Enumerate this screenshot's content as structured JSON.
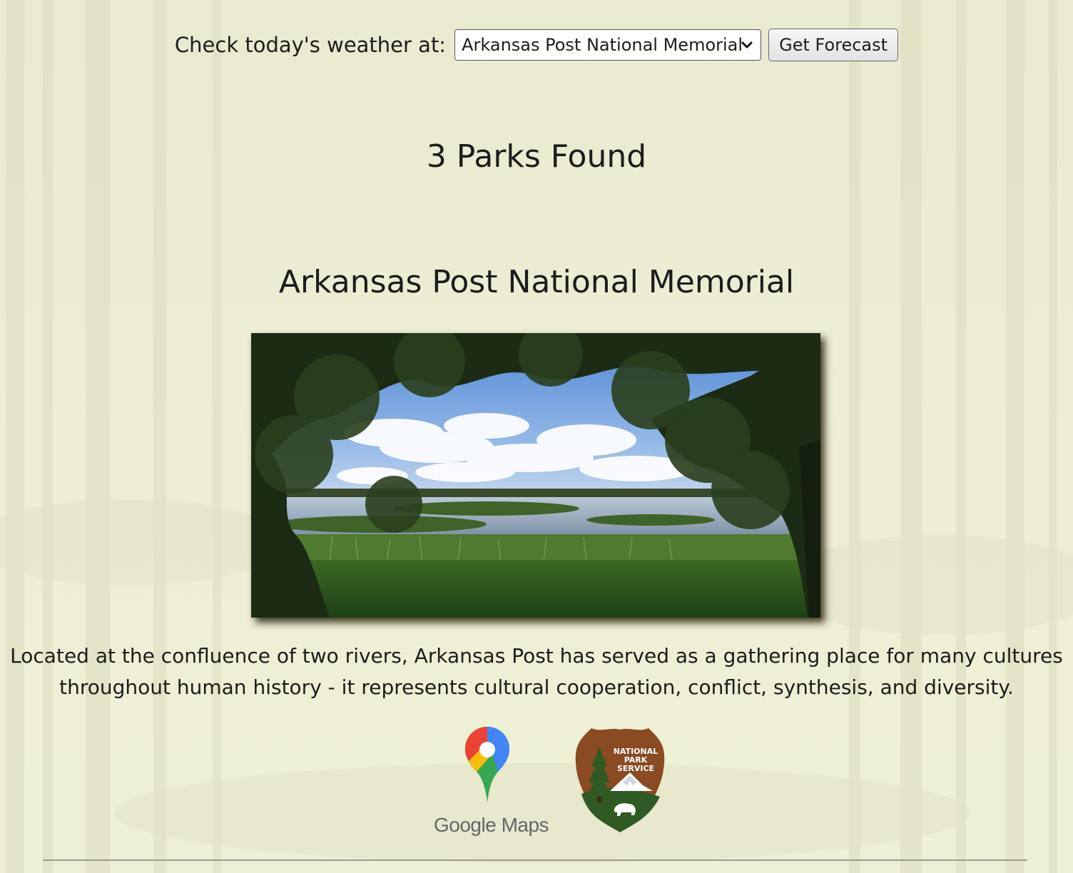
{
  "weather": {
    "label": "Check today's weather at:",
    "selected_park": "Arkansas Post National Memorial",
    "button_label": "Get Forecast"
  },
  "results": {
    "count_text": "3 Parks Found"
  },
  "park": {
    "name": "Arkansas Post National Memorial",
    "description": "Located at the confluence of two rivers, Arkansas Post has served as a gathering place for many cultures throughout human history - it represents cultural cooperation, conflict, synthesis, and diversity.",
    "photo_subject": "lake-through-trees",
    "links": {
      "google_maps_text": "Google Maps",
      "nps_logo_lines": [
        "NATIONAL",
        "PARK",
        "SERVICE"
      ]
    }
  },
  "colors": {
    "background": "#eeeed2",
    "text": "#1c1c1c",
    "divider": "#9a9a9a",
    "nps_brown": "#8a4a22",
    "nps_green": "#2f5a23"
  }
}
